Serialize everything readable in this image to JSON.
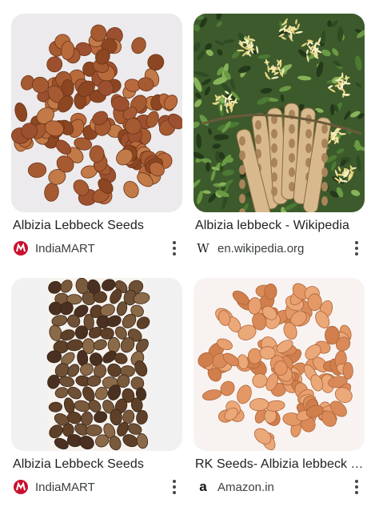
{
  "results": [
    {
      "title": "Albizia Lebbeck Seeds",
      "source": "IndiaMART",
      "favicon": "indiamart-logo-icon"
    },
    {
      "title": "Albizia lebbeck - Wikipedia",
      "source": "en.wikipedia.org",
      "favicon": "wikipedia-w-icon",
      "favicon_glyph": "W"
    },
    {
      "title": "Albizia Lebbeck Seeds",
      "source": "IndiaMART",
      "favicon": "indiamart-logo-icon"
    },
    {
      "title": "RK Seeds- Albizia lebbeck Tree Seeds",
      "source": "Amazon.in",
      "favicon": "amazon-a-icon",
      "favicon_glyph": "a"
    }
  ],
  "colors": {
    "seed_brown": "#9a5530",
    "seed_light": "#e39866",
    "indiamart_red": "#c8102e",
    "text_primary": "#202124",
    "text_secondary": "#3c4043"
  }
}
